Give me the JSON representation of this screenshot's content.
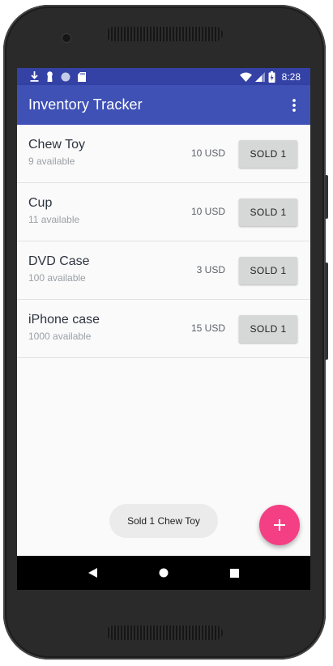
{
  "status_bar": {
    "time": "8:28",
    "left_icons": [
      "download-icon",
      "keyhole-icon",
      "circle-icon",
      "sd-card-icon"
    ],
    "right_icons": [
      "wifi-icon",
      "cell-signal-icon",
      "battery-icon"
    ]
  },
  "app_bar": {
    "title": "Inventory Tracker",
    "menu_icon": "overflow-menu-icon"
  },
  "products": [
    {
      "name": "Chew Toy",
      "availability": "9 available",
      "price": "10 USD",
      "button": "SOLD 1"
    },
    {
      "name": "Cup",
      "availability": "11 available",
      "price": "10 USD",
      "button": "SOLD 1"
    },
    {
      "name": "DVD Case",
      "availability": "100 available",
      "price": "3 USD",
      "button": "SOLD 1"
    },
    {
      "name": "iPhone case",
      "availability": "1000 available",
      "price": "15 USD",
      "button": "SOLD 1"
    }
  ],
  "toast": {
    "message": "Sold 1 Chew Toy"
  },
  "fab": {
    "icon": "plus-icon",
    "color": "#f43f84"
  },
  "nav_bar": {
    "icons": [
      "back-icon",
      "home-icon",
      "recents-icon"
    ]
  },
  "colors": {
    "primary": "#3f51b5",
    "primary_dark": "#3442a6",
    "accent": "#f43f84",
    "button": "#d6d7d7"
  }
}
